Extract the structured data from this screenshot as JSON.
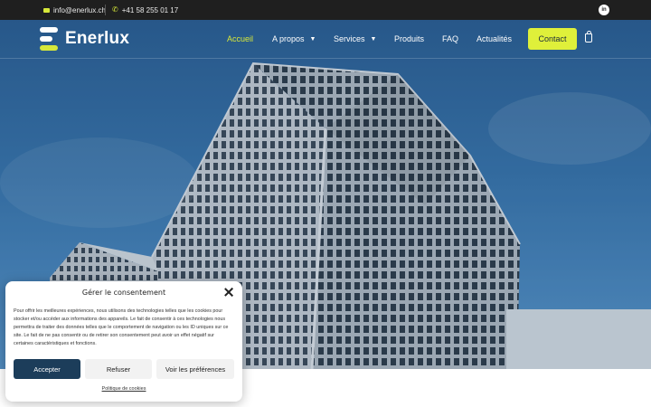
{
  "topbar": {
    "email": "info@enerlux.ch",
    "phone": "+41 58 255 01 17",
    "social": {
      "linkedin_label": "in"
    }
  },
  "header": {
    "logo_text": "Enerlux",
    "nav": [
      {
        "label": "Accueil",
        "active": true
      },
      {
        "label": "A propos",
        "has_dropdown": true
      },
      {
        "label": "Services",
        "has_dropdown": true
      },
      {
        "label": "Produits"
      },
      {
        "label": "FAQ"
      },
      {
        "label": "Actualités"
      }
    ],
    "contact_label": "Contact",
    "cart_icon": "shopping-bag-icon"
  },
  "hero": {
    "image": "office-tower-photo"
  },
  "consent": {
    "title": "Gérer le consentement",
    "body": "Pour offrir les meilleures expériences, nous utilisons des technologies telles que les cookies pour stocker et/ou accéder aux informations des appareils. Le fait de consentir à ces technologies nous permettra de traiter des données telles que le comportement de navigation ou les ID uniques sur ce site. Le fait de ne pas consentir ou de retirer son consentement peut avoir un effet négatif sur certaines caractéristiques et fonctions.",
    "accept_label": "Accepter",
    "refuse_label": "Refuser",
    "prefs_label": "Voir les préférences",
    "policy_label": "Politique de cookies"
  },
  "colors": {
    "accent": "#d7e83a",
    "topbar": "#1f1f1f",
    "primary_button": "#1c3d5a"
  }
}
